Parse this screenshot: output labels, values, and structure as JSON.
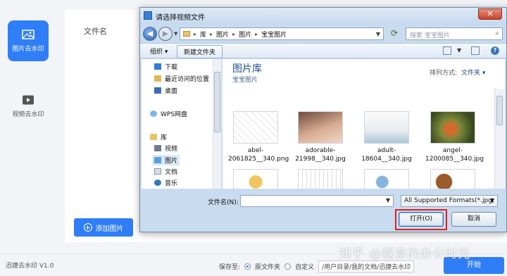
{
  "app": {
    "sidebar": [
      {
        "label": "图片去水印",
        "icon": "image-icon",
        "active": true
      },
      {
        "label": "视频去水印",
        "icon": "play-icon",
        "active": false
      }
    ],
    "columns": {
      "filename": "文件名"
    },
    "add_button": "添加图片",
    "version": "迅捷去水印 V1.0",
    "save_to_label": "保存至:",
    "save_options": [
      "原文件夹",
      "自定义"
    ],
    "save_path": "/用户目录/我的文档/迅捷去水印",
    "start_button": "开始",
    "watermark_text": "知乎 @惬意的办公时光",
    "accent_color": "#2f7ef7"
  },
  "dialog": {
    "title": "请选择视频文件",
    "close": "✕",
    "breadcrumb": [
      "库",
      "图片",
      "图片",
      "宝宝图片"
    ],
    "search_placeholder": "搜索 宝宝图片",
    "toolbar": {
      "organize": "组织 ▾",
      "new_folder": "新建文件夹"
    },
    "nav": [
      {
        "label": "下载",
        "icon": "download-icon"
      },
      {
        "label": "最近访问的位置",
        "icon": "recent-icon"
      },
      {
        "label": "桌面",
        "icon": "desktop-icon"
      },
      {
        "label": "WPS网盘",
        "icon": "cloud-icon"
      },
      {
        "label": "库",
        "icon": "library-icon"
      },
      {
        "label": "视频",
        "icon": "video-icon"
      },
      {
        "label": "图片",
        "icon": "pictures-icon"
      },
      {
        "label": "文档",
        "icon": "documents-icon"
      },
      {
        "label": "音乐",
        "icon": "music-icon"
      }
    ],
    "library_title": "图片库",
    "library_sub": "宝宝图片",
    "arrange_label": "排列方式:",
    "arrange_value": "文件夹 ▾",
    "files": [
      {
        "name": "abel-2061825__340.png"
      },
      {
        "name": "adorable-21998__340.jpg"
      },
      {
        "name": "adult-18604__340.jpg"
      },
      {
        "name": "angel-1200085__340.jpg"
      }
    ],
    "filename_label": "文件名(N):",
    "filename_value": "",
    "filter": "All Supported Formats(*.jpg;",
    "open_button": "打开(O)",
    "cancel_button": "取消"
  }
}
